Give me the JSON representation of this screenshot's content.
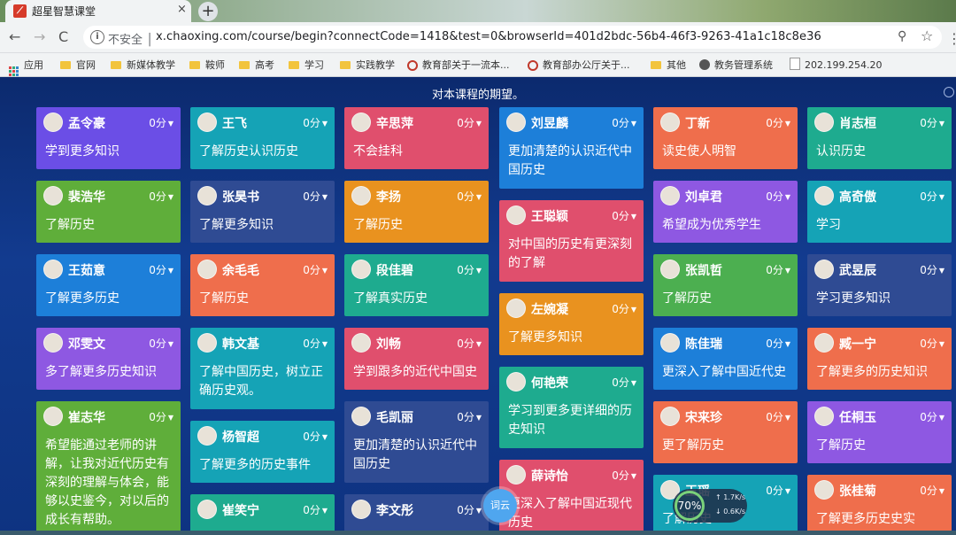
{
  "browser": {
    "tab_title": "超星智慧课堂",
    "tab_close": "×",
    "new_tab": "+",
    "nav": {
      "back": "←",
      "forward": "→",
      "reload": "C"
    },
    "security_label": "不安全",
    "url": "x.chaoxing.com/course/begin?connectCode=1418&test=0&browserId=401d2bdc-56b4-46f3-9263-41a1c18c8e36",
    "zoom_glyph": "⚲",
    "star_glyph": "☆",
    "menu_glyph": "⋮"
  },
  "bookmarks": [
    "应用",
    "官网",
    "新媒体教学",
    "鞍师",
    "高考",
    "学习",
    "实践教学",
    "教育部关于一流本...",
    "教育部办公厅关于...",
    "其他",
    "教务管理系统",
    "202.199.254.20"
  ],
  "page": {
    "headline": "对本课程的期望。",
    "score_label": "0分",
    "caret": "▼"
  },
  "cards": [
    {
      "name": "孟令豪",
      "text": "学到更多知识"
    },
    {
      "name": "裴浩华",
      "text": "了解历史"
    },
    {
      "name": "王茹意",
      "text": "了解更多历史"
    },
    {
      "name": "邓雯文",
      "text": "多了解更多历史知识"
    },
    {
      "name": "崔志华",
      "text": "希望能通过老师的讲解，让我对近代历史有深刻的理解与体会，能够以史鉴今，对以后的成长有帮助。"
    },
    {
      "name": "王飞",
      "text": "了解历史认识历史"
    },
    {
      "name": "张昊书",
      "text": "了解更多知识"
    },
    {
      "name": "余毛毛",
      "text": "了解历史"
    },
    {
      "name": "韩文基",
      "text": "了解中国历史，树立正确历史观。"
    },
    {
      "name": "杨智超",
      "text": "了解更多的历史事件"
    },
    {
      "name": "崔笑宁",
      "text": ""
    },
    {
      "name": "辛思萍",
      "text": "不会挂科"
    },
    {
      "name": "李扬",
      "text": "了解历史"
    },
    {
      "name": "段佳碧",
      "text": "了解真实历史"
    },
    {
      "name": "刘畅",
      "text": "学到跟多的近代中国史"
    },
    {
      "name": "毛凯丽",
      "text": "更加清楚的认识近代中国历史"
    },
    {
      "name": "李文彤",
      "text": ""
    },
    {
      "name": "刘昱麟",
      "text": "更加清楚的认识近代中国历史"
    },
    {
      "name": "王聪颖",
      "text": "对中国的历史有更深刻的了解"
    },
    {
      "name": "左婉凝",
      "text": "了解更多知识"
    },
    {
      "name": "何艳荣",
      "text": "学习到更多更详细的历史知识"
    },
    {
      "name": "薛诗怡",
      "text": "更深入了解中国近现代历史"
    },
    {
      "name": "丁新",
      "text": "读史使人明智"
    },
    {
      "name": "刘卓君",
      "text": "希望成为优秀学生"
    },
    {
      "name": "张凯哲",
      "text": "了解历史"
    },
    {
      "name": "陈佳瑞",
      "text": "更深入了解中国近代史"
    },
    {
      "name": "宋来珍",
      "text": "更了解历史"
    },
    {
      "name": "王瑶",
      "text": "了解历史"
    },
    {
      "name": "肖志桓",
      "text": "认识历史"
    },
    {
      "name": "高奇傲",
      "text": "学习"
    },
    {
      "name": "武昱辰",
      "text": "学习更多知识"
    },
    {
      "name": "臧一宁",
      "text": "了解更多的历史知识"
    },
    {
      "name": "任桐玉",
      "text": "了解历史"
    },
    {
      "name": "张桂菊",
      "text": "了解更多历史史实"
    }
  ],
  "floating": {
    "wordcloud_button": "词云",
    "speed_percent": "70%",
    "upload": "1.7K/s",
    "download": "0.6K/s"
  }
}
